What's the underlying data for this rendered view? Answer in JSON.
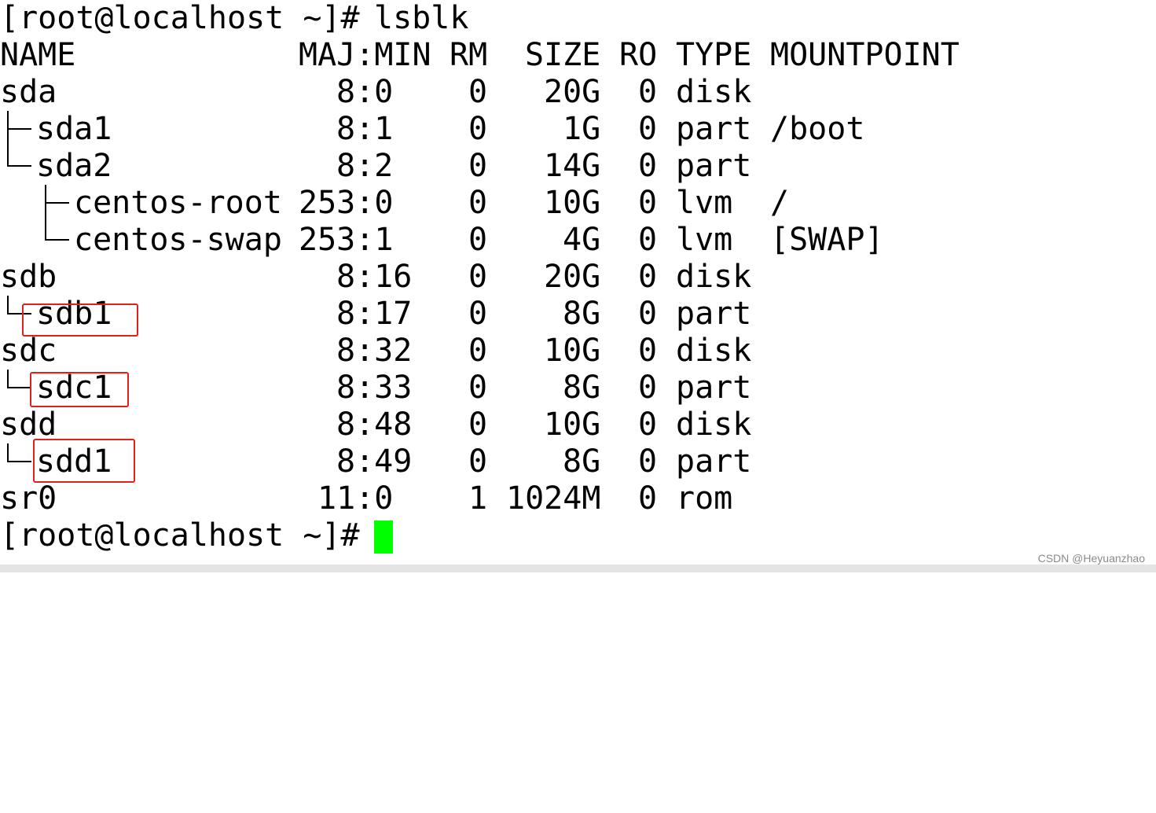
{
  "prompt": "[root@localhost ~]# ",
  "command": "lsblk",
  "header": {
    "name": "NAME",
    "majmin": "MAJ:MIN",
    "rm": "RM",
    "size": "SIZE",
    "ro": "RO",
    "type": "TYPE",
    "mountpoint": "MOUNTPOINT"
  },
  "rows": [
    {
      "name": "sda",
      "majmin": "8:0",
      "rm": "0",
      "size": "20G",
      "ro": "0",
      "type": "disk",
      "mountpoint": ""
    },
    {
      "name": "sda1",
      "majmin": "8:1",
      "rm": "0",
      "size": "1G",
      "ro": "0",
      "type": "part",
      "mountpoint": "/boot"
    },
    {
      "name": "sda2",
      "majmin": "8:2",
      "rm": "0",
      "size": "14G",
      "ro": "0",
      "type": "part",
      "mountpoint": ""
    },
    {
      "name": "centos-root",
      "majmin": "253:0",
      "rm": "0",
      "size": "10G",
      "ro": "0",
      "type": "lvm",
      "mountpoint": "/"
    },
    {
      "name": "centos-swap",
      "majmin": "253:1",
      "rm": "0",
      "size": "4G",
      "ro": "0",
      "type": "lvm",
      "mountpoint": "[SWAP]"
    },
    {
      "name": "sdb",
      "majmin": "8:16",
      "rm": "0",
      "size": "20G",
      "ro": "0",
      "type": "disk",
      "mountpoint": ""
    },
    {
      "name": "sdb1",
      "majmin": "8:17",
      "rm": "0",
      "size": "8G",
      "ro": "0",
      "type": "part",
      "mountpoint": ""
    },
    {
      "name": "sdc",
      "majmin": "8:32",
      "rm": "0",
      "size": "10G",
      "ro": "0",
      "type": "disk",
      "mountpoint": ""
    },
    {
      "name": "sdc1",
      "majmin": "8:33",
      "rm": "0",
      "size": "8G",
      "ro": "0",
      "type": "part",
      "mountpoint": ""
    },
    {
      "name": "sdd",
      "majmin": "8:48",
      "rm": "0",
      "size": "10G",
      "ro": "0",
      "type": "disk",
      "mountpoint": ""
    },
    {
      "name": "sdd1",
      "majmin": "8:49",
      "rm": "0",
      "size": "8G",
      "ro": "0",
      "type": "part",
      "mountpoint": ""
    },
    {
      "name": "sr0",
      "majmin": "11:0",
      "rm": "1",
      "size": "1024M",
      "ro": "0",
      "type": "rom",
      "mountpoint": ""
    }
  ],
  "colors": {
    "background": "#ffffff",
    "text": "#000000",
    "cursor": "#00ff00",
    "highlight": "#e0201c"
  },
  "watermark": "CSDN @Heyuanzhao"
}
